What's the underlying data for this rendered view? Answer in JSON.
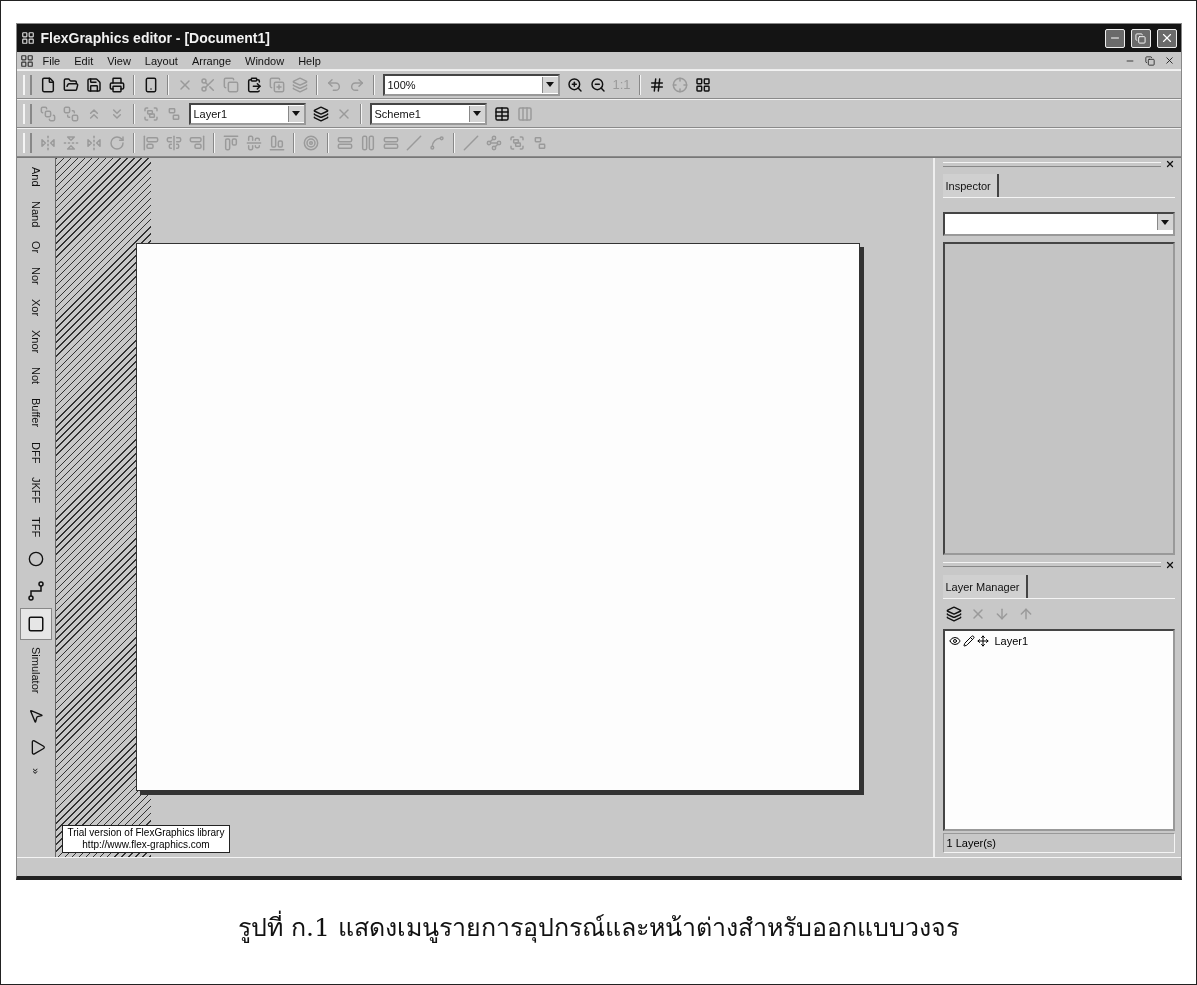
{
  "window": {
    "title": "FlexGraphics editor - [Document1]"
  },
  "menu": [
    {
      "label": "File"
    },
    {
      "label": "Edit"
    },
    {
      "label": "View"
    },
    {
      "label": "Layout"
    },
    {
      "label": "Arrange"
    },
    {
      "label": "Window"
    },
    {
      "label": "Help"
    }
  ],
  "toolbars": [
    [
      {
        "kind": "new",
        "disabled": false
      },
      {
        "kind": "open",
        "disabled": false
      },
      {
        "kind": "save",
        "disabled": false
      },
      {
        "kind": "print",
        "disabled": false
      },
      {
        "kind": "separator"
      },
      {
        "kind": "properties",
        "disabled": false
      },
      {
        "kind": "separator"
      },
      {
        "kind": "delete",
        "disabled": true
      },
      {
        "kind": "cut",
        "disabled": true
      },
      {
        "kind": "copy",
        "disabled": true
      },
      {
        "kind": "paste",
        "disabled": false
      },
      {
        "kind": "duplicate",
        "disabled": true
      },
      {
        "kind": "clone",
        "disabled": true
      },
      {
        "kind": "separator"
      },
      {
        "kind": "undo",
        "disabled": true
      },
      {
        "kind": "redo",
        "disabled": true
      },
      {
        "kind": "separator"
      },
      {
        "kind": "combo",
        "value": "100%"
      },
      {
        "kind": "zoom-in",
        "disabled": false
      },
      {
        "kind": "zoom-out",
        "disabled": false
      },
      {
        "kind": "text",
        "label": "1:1",
        "disabled": true
      },
      {
        "kind": "separator"
      },
      {
        "kind": "grid",
        "disabled": false
      },
      {
        "kind": "snap",
        "disabled": true
      },
      {
        "kind": "grid-settings",
        "disabled": false
      }
    ],
    [
      {
        "kind": "bring-front",
        "disabled": true
      },
      {
        "kind": "send-back",
        "disabled": true
      },
      {
        "kind": "forward",
        "disabled": true
      },
      {
        "kind": "backward",
        "disabled": true
      },
      {
        "kind": "separator"
      },
      {
        "kind": "group",
        "disabled": true
      },
      {
        "kind": "ungroup",
        "disabled": true
      },
      {
        "kind": "combo",
        "value": "Layer1"
      },
      {
        "kind": "add-layer",
        "disabled": false
      },
      {
        "kind": "delete-layer",
        "disabled": true
      },
      {
        "kind": "separator"
      },
      {
        "kind": "combo",
        "value": "Scheme1"
      },
      {
        "kind": "scheme-table",
        "disabled": false
      },
      {
        "kind": "scheme-grid",
        "disabled": true
      }
    ],
    [
      {
        "kind": "flip-h",
        "disabled": true
      },
      {
        "kind": "flip-v",
        "disabled": true
      },
      {
        "kind": "mirror",
        "disabled": true
      },
      {
        "kind": "rotate",
        "disabled": true
      },
      {
        "kind": "separator"
      },
      {
        "kind": "align-left",
        "disabled": true
      },
      {
        "kind": "align-center",
        "disabled": true
      },
      {
        "kind": "align-right",
        "disabled": true
      },
      {
        "kind": "separator"
      },
      {
        "kind": "align-top",
        "disabled": true
      },
      {
        "kind": "align-middle",
        "disabled": true
      },
      {
        "kind": "align-bottom",
        "disabled": true
      },
      {
        "kind": "separator"
      },
      {
        "kind": "center-page",
        "disabled": true
      },
      {
        "kind": "separator"
      },
      {
        "kind": "space-h",
        "disabled": true
      },
      {
        "kind": "space-v",
        "disabled": true
      },
      {
        "kind": "space-even",
        "disabled": true
      },
      {
        "kind": "line",
        "disabled": true
      },
      {
        "kind": "curve",
        "disabled": true
      },
      {
        "kind": "separator"
      },
      {
        "kind": "line",
        "disabled": true
      },
      {
        "kind": "points",
        "disabled": true
      },
      {
        "kind": "group",
        "disabled": true
      },
      {
        "kind": "ungroup",
        "disabled": true
      }
    ]
  ],
  "palette": [
    {
      "kind": "text",
      "label": "And",
      "selected": false
    },
    {
      "kind": "text",
      "label": "Nand",
      "selected": false
    },
    {
      "kind": "text",
      "label": "Or",
      "selected": false
    },
    {
      "kind": "text",
      "label": "Nor",
      "selected": false
    },
    {
      "kind": "text",
      "label": "Xor",
      "selected": false
    },
    {
      "kind": "text",
      "label": "Xnor",
      "selected": false
    },
    {
      "kind": "text",
      "label": "Not",
      "selected": false
    },
    {
      "kind": "text",
      "label": "Buffer",
      "selected": false
    },
    {
      "kind": "text",
      "label": "DFF",
      "selected": false
    },
    {
      "kind": "text",
      "label": "JKFF",
      "selected": false
    },
    {
      "kind": "text",
      "label": "TFF",
      "selected": false
    },
    {
      "kind": "ellipse",
      "selected": false
    },
    {
      "kind": "connector",
      "selected": false
    },
    {
      "kind": "rectangle",
      "selected": true
    },
    {
      "kind": "text",
      "label": "Simulator",
      "selected": false
    },
    {
      "kind": "pointer",
      "selected": false
    },
    {
      "kind": "triangle",
      "selected": false
    },
    {
      "kind": "text",
      "label": "»",
      "selected": false
    }
  ],
  "canvas": {
    "notice": [
      "Trial version of FlexGraphics library",
      "http://www.flex-graphics.com"
    ]
  },
  "inspector": {
    "tab": {
      "label": "Inspector",
      "selected": true
    }
  },
  "layer_manager": {
    "tab": {
      "label": "Layer Manager",
      "selected": true
    },
    "toolbar": [
      {
        "kind": "add-layer",
        "disabled": false
      },
      {
        "kind": "delete-layer",
        "disabled": true
      },
      {
        "kind": "down",
        "disabled": true
      },
      {
        "kind": "up",
        "disabled": true
      }
    ],
    "layers": [
      {
        "name": "Layer1"
      }
    ],
    "status": "1 Layer(s)"
  },
  "caption": "รูปที่ ก.1 แสดงเมนูรายการอุปกรณ์และหน้าต่างสำหรับออกแบบวงจร"
}
